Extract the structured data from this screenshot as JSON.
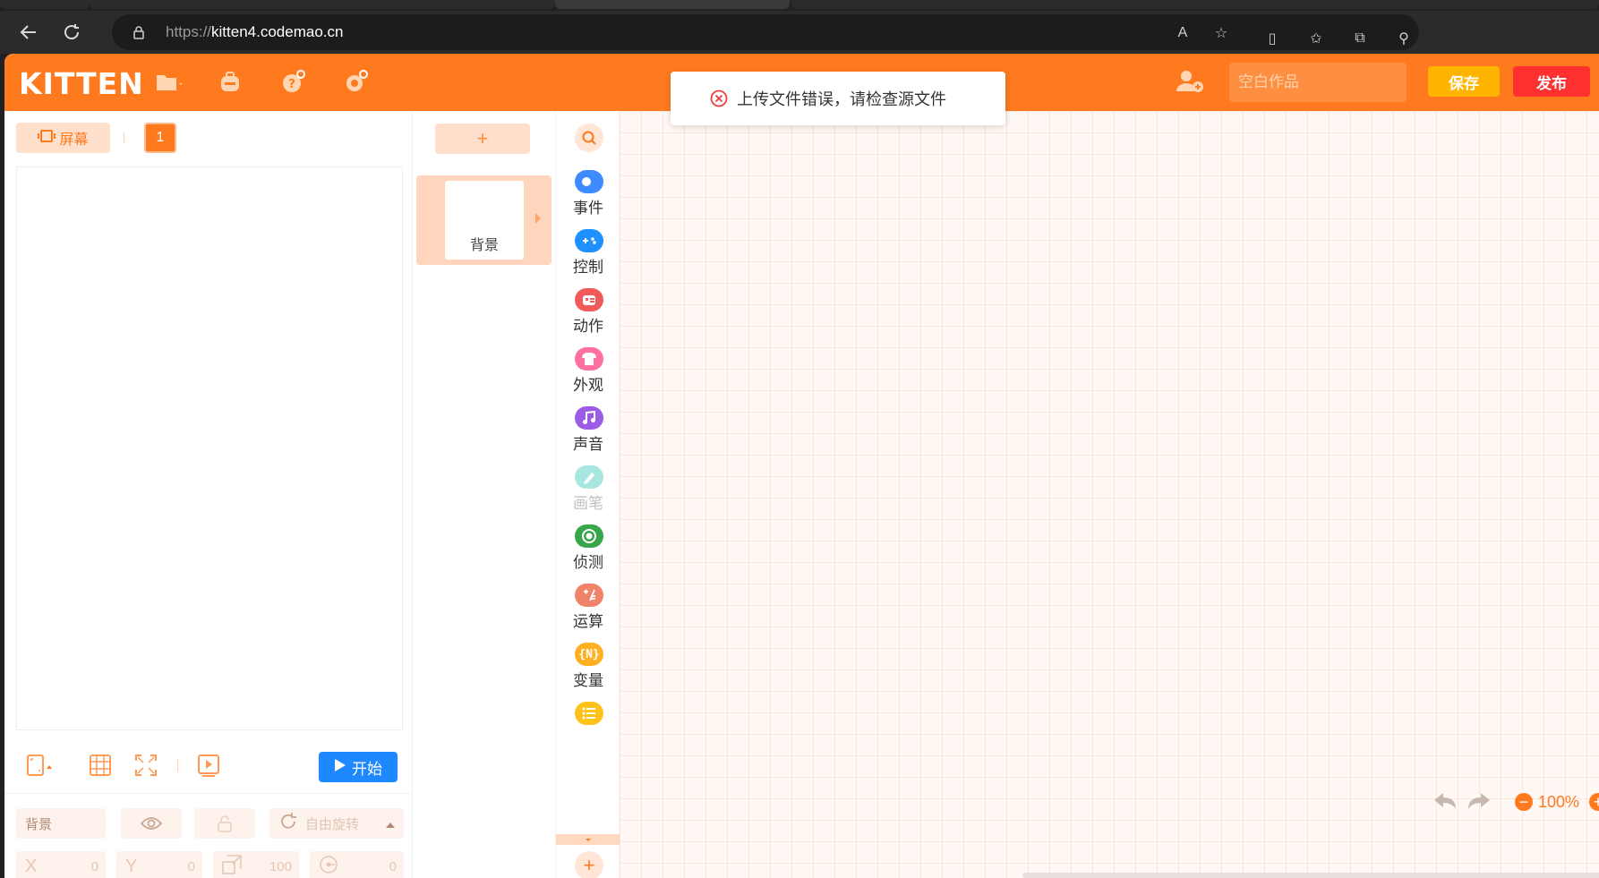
{
  "browser": {
    "url_scheme": "https://",
    "url_host": "kitten4.codemao.cn"
  },
  "app": {
    "logo": "KITTEN",
    "title_placeholder": "空白作品",
    "save_label": "保存",
    "publish_label": "发布",
    "accent_color": "#ff7a1e"
  },
  "toast": {
    "message": "上传文件错误，请检查源文件"
  },
  "stage": {
    "screen_label": "屏幕",
    "page_number": "1",
    "start_label": "开始"
  },
  "properties": {
    "name": "背景",
    "rotation_label": "自由旋转",
    "x_label": "X",
    "x_value": "0",
    "y_label": "Y",
    "y_value": "0",
    "scale_value": "100",
    "direction_value": "0"
  },
  "sprites": {
    "add_label": "+",
    "items": [
      {
        "label": "背景"
      }
    ]
  },
  "palette": {
    "categories": [
      {
        "label": "事件",
        "color": "#3d8bff",
        "icon": "toggle-icon"
      },
      {
        "label": "控制",
        "color": "#1e90ff",
        "icon": "gamepad-icon"
      },
      {
        "label": "动作",
        "color": "#f05a5a",
        "icon": "robot-icon"
      },
      {
        "label": "外观",
        "color": "#ff6fa0",
        "icon": "shirt-icon"
      },
      {
        "label": "声音",
        "color": "#9b5ce6",
        "icon": "music-icon"
      },
      {
        "label": "画笔",
        "color": "#a8e6e0",
        "icon": "pen-icon"
      },
      {
        "label": "侦测",
        "color": "#3aa64a",
        "icon": "radar-icon"
      },
      {
        "label": "运算",
        "color": "#f0826a",
        "icon": "math-icon"
      },
      {
        "label": "变量",
        "color": "#ffb020",
        "icon": "variable-icon"
      }
    ],
    "list_color": "#ffc21a"
  },
  "workspace": {
    "zoom_level": "100%"
  }
}
